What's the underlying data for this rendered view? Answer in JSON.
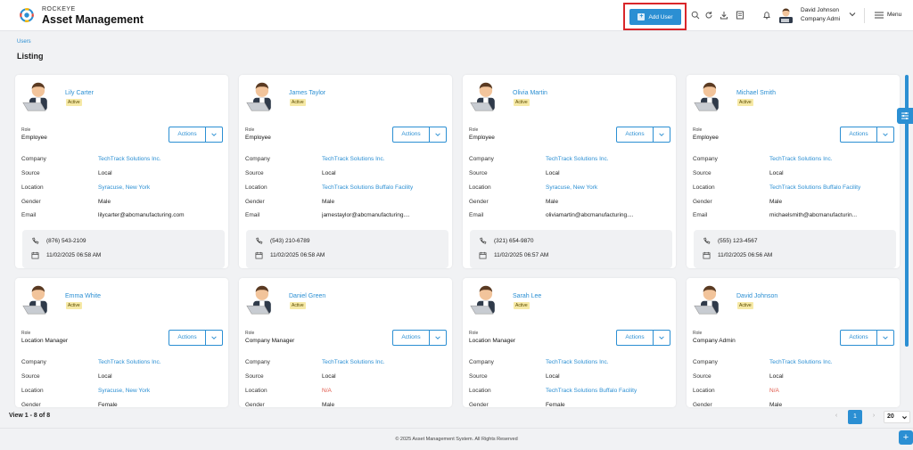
{
  "header": {
    "brand_small": "ROCKEYE",
    "brand_large": "Asset Management",
    "add_user_label": "Add User",
    "user_name": "David Johnson",
    "user_role": "Company Admi",
    "menu_label": "Menu",
    "icons": [
      "search-icon",
      "refresh-icon",
      "download-icon",
      "document-icon",
      "bell-icon"
    ]
  },
  "page": {
    "breadcrumb": "Users",
    "title": "Listing"
  },
  "labels": {
    "role": "Role",
    "actions": "Actions",
    "company": "Company",
    "source": "Source",
    "location": "Location",
    "gender": "Gender",
    "email": "Email"
  },
  "users": [
    {
      "name": "Lily Carter",
      "status": "Active",
      "role": "Employee",
      "company": "TechTrack Solutions Inc.",
      "source": "Local",
      "location": "Syracuse, New York",
      "location_type": "link",
      "gender": "Male",
      "email": "lilycarter@abcmanufacturing.com",
      "phone": "(876) 543-2109",
      "date": "11/02/2025 06:58 AM"
    },
    {
      "name": "James Taylor",
      "status": "Active",
      "role": "Employee",
      "company": "TechTrack Solutions Inc.",
      "source": "Local",
      "location": "TechTrack Solutions Buffalo Facility",
      "location_type": "link",
      "gender": "Male",
      "email": "jamestaylor@abcmanufacturing....",
      "phone": "(543) 210-6789",
      "date": "11/02/2025 06:58 AM"
    },
    {
      "name": "Olivia Martin",
      "status": "Active",
      "role": "Employee",
      "company": "TechTrack Solutions Inc.",
      "source": "Local",
      "location": "Syracuse, New York",
      "location_type": "link",
      "gender": "Male",
      "email": "oliviamartin@abcmanufacturing....",
      "phone": "(321) 654-9870",
      "date": "11/02/2025 06:57 AM"
    },
    {
      "name": "Michael Smith",
      "status": "Active",
      "role": "Employee",
      "company": "TechTrack Solutions Inc.",
      "source": "Local",
      "location": "TechTrack Solutions Buffalo Facility",
      "location_type": "link",
      "gender": "Male",
      "email": "michaelsmith@abcmanufacturin...",
      "phone": "(555) 123-4567",
      "date": "11/02/2025 06:56 AM"
    },
    {
      "name": "Emma White",
      "status": "Active",
      "role": "Location Manager",
      "company": "TechTrack Solutions Inc.",
      "source": "Local",
      "location": "Syracuse, New York",
      "location_type": "link",
      "gender": "Female"
    },
    {
      "name": "Daniel Green",
      "status": "Active",
      "role": "Company Manager",
      "company": "TechTrack Solutions Inc.",
      "source": "Local",
      "location": "N/A",
      "location_type": "na",
      "gender": "Male"
    },
    {
      "name": "Sarah Lee",
      "status": "Active",
      "role": "Location Manager",
      "company": "TechTrack Solutions Inc.",
      "source": "Local",
      "location": "TechTrack Solutions Buffalo Facility",
      "location_type": "link",
      "gender": "Female"
    },
    {
      "name": "David Johnson",
      "status": "Active",
      "role": "Company Admin",
      "company": "TechTrack Solutions Inc.",
      "source": "Local",
      "location": "N/A",
      "location_type": "na",
      "gender": "Male"
    }
  ],
  "footer": {
    "view_count": "View 1 - 8 of 8",
    "current_page": "1",
    "per_page": "20",
    "copyright": "© 2025 Asset Management System. All Rights Reserved"
  },
  "colors": {
    "accent": "#2b8fd3",
    "status_bg": "#f6e9a6",
    "na": "#e0584a",
    "highlight": "#d9262a"
  }
}
